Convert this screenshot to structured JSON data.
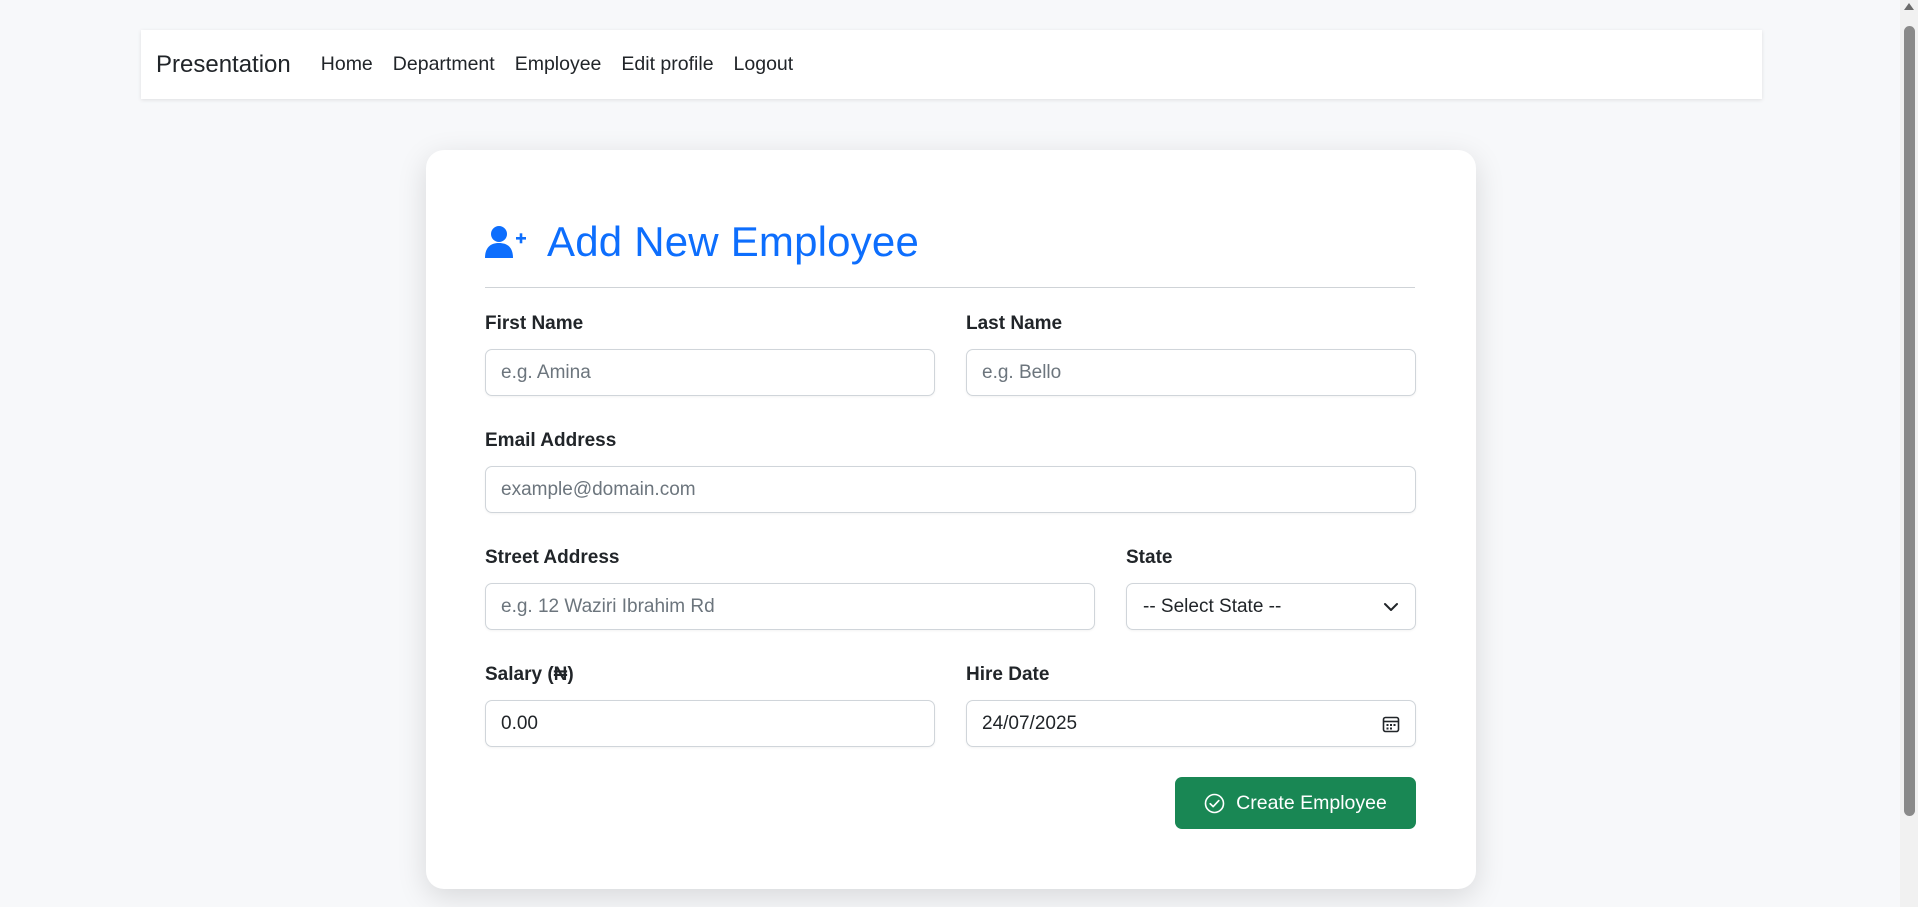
{
  "navbar": {
    "brand": "Presentation",
    "links": [
      "Home",
      "Department",
      "Employee",
      "Edit profile",
      "Logout"
    ]
  },
  "form": {
    "title": "Add New Employee",
    "title_icon": "user-plus-icon",
    "first_name": {
      "label": "First Name",
      "placeholder": "e.g. Amina"
    },
    "last_name": {
      "label": "Last Name",
      "placeholder": "e.g. Bello"
    },
    "email": {
      "label": "Email Address",
      "placeholder": "example@domain.com"
    },
    "street": {
      "label": "Street Address",
      "placeholder": "e.g. 12 Waziri Ibrahim Rd"
    },
    "state": {
      "label": "State",
      "selected": "-- Select State --",
      "icon": "chevron-down-icon"
    },
    "salary": {
      "label": "Salary (₦)",
      "value": "0.00"
    },
    "hire_date": {
      "label": "Hire Date",
      "value": "24/07/2025",
      "icon": "calendar-icon"
    },
    "submit": {
      "label": "Create Employee",
      "icon": "check-circle-icon"
    }
  },
  "colors": {
    "primary": "#0d6efd",
    "success": "#198754",
    "page_background": "#f7f8fa"
  }
}
